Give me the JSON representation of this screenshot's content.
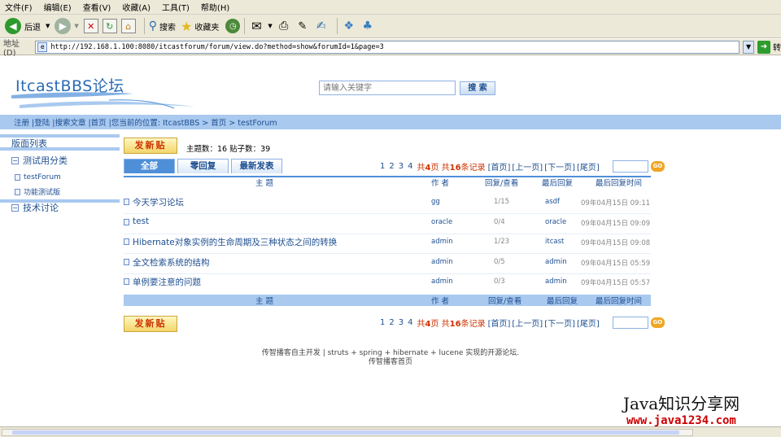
{
  "browser": {
    "menu": [
      "文件(F)",
      "编辑(E)",
      "查看(V)",
      "收藏(A)",
      "工具(T)",
      "帮助(H)"
    ],
    "toolbar": {
      "back": "后退",
      "search": "搜索",
      "favorites": "收藏夹"
    },
    "address": {
      "label": "地址(D)",
      "url": "http://192.168.1.100:8080/itcastforum/forum/view.do?method=show&forumId=1&page=3",
      "go": "转"
    }
  },
  "site": {
    "logo": "ItcastBBS论坛",
    "search_placeholder": "请输入关键字",
    "search_button": "搜 索",
    "nav": "注册 |登陆 |搜索文章 |首页 |您当前的位置: ItcastBBS > 首页 > testForum"
  },
  "sidebar": {
    "title": "版面列表",
    "groups": [
      {
        "label": "测试用分类",
        "toggle": "⊟",
        "items": [
          "testForum",
          "功能测试版"
        ]
      },
      {
        "label": "技术讨论",
        "toggle": "⊟",
        "items": []
      }
    ]
  },
  "forum": {
    "post_button": "发新贴",
    "counts": "主题数：16 贴子数：39",
    "tabs": [
      {
        "label": "全部",
        "active": true
      },
      {
        "label": "零回复",
        "active": false
      },
      {
        "label": "最新发表",
        "active": false
      }
    ],
    "pager": {
      "pages": [
        "1",
        "2",
        "3",
        "4"
      ],
      "total_pages_prefix": "共",
      "total_pages": "4",
      "total_pages_suffix": "页",
      "total_records_prefix": " 共",
      "total_records": "16",
      "total_records_suffix": "条记录",
      "first": "[首页]",
      "prev": "[上一页]",
      "next": "[下一页]",
      "last": "[尾页]",
      "go": "GO"
    },
    "columns": {
      "topic": "主 题",
      "author": "作 者",
      "reply_view": "回复/查看",
      "last_reply": "最后回复",
      "last_reply_time": "最后回复时间"
    },
    "threads": [
      {
        "title": "今天学习论坛",
        "author": "gg",
        "reply_view": "1/15",
        "last_reply": "asdf",
        "time": "09年04月15日 09:11"
      },
      {
        "title": "test",
        "author": "oracle",
        "reply_view": "0/4",
        "last_reply": "oracle",
        "time": "09年04月15日 09:09"
      },
      {
        "title": "Hibernate对象实例的生命周期及三种状态之间的转换",
        "author": "admin",
        "reply_view": "1/23",
        "last_reply": "itcast",
        "time": "09年04月15日 09:08"
      },
      {
        "title": "全文检索系统的结构",
        "author": "admin",
        "reply_view": "0/5",
        "last_reply": "admin",
        "time": "09年04月15日 05:59"
      },
      {
        "title": "单例要注意的问题",
        "author": "admin",
        "reply_view": "0/3",
        "last_reply": "admin",
        "time": "09年04月15日 05:57"
      }
    ]
  },
  "footer": {
    "line1": "传智播客自主开发 | struts + spring + hibernate + lucene 实现的开源论坛.",
    "line2": "传智播客首页"
  },
  "watermark": {
    "line1": "Java知识分享网",
    "line2": "www.java1234.com"
  }
}
